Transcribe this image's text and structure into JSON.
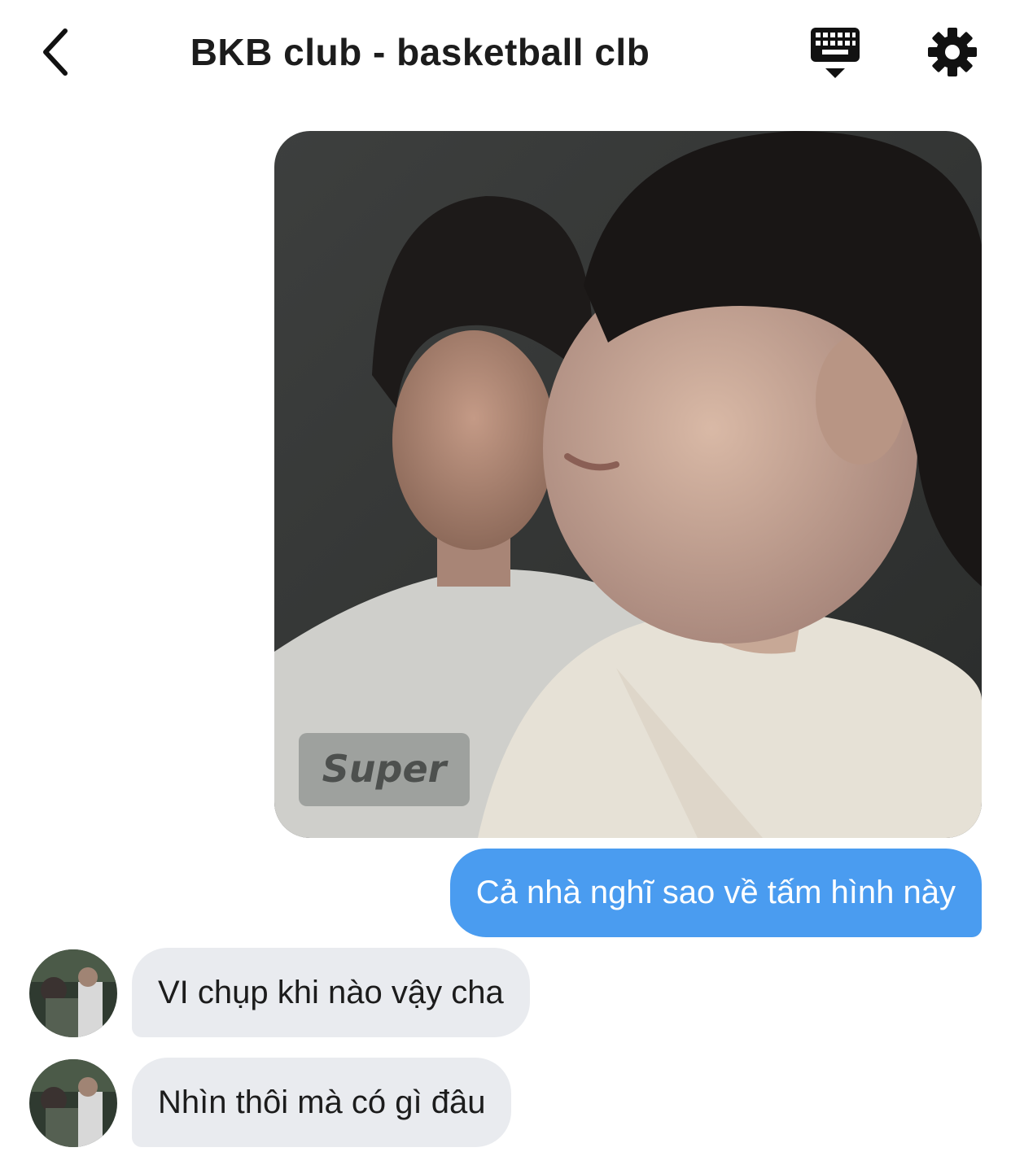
{
  "header": {
    "title": "BKB club - basketball clb",
    "back_icon": "chevron-left-icon",
    "keyboard_icon": "keyboard-hide-icon",
    "settings_icon": "gear-icon"
  },
  "messages": [
    {
      "type": "image",
      "direction": "outgoing",
      "content": "photo-of-two-people",
      "image_caption": "Super"
    },
    {
      "type": "text",
      "direction": "outgoing",
      "text": "Cả nhà nghĩ sao về tấm hình này"
    },
    {
      "type": "text",
      "direction": "incoming",
      "text": "VI chụp khi nào vậy cha"
    },
    {
      "type": "text",
      "direction": "incoming",
      "text": "Nhìn thôi mà có gì đâu"
    }
  ],
  "colors": {
    "outgoing_bubble": "#4a9cf0",
    "incoming_bubble": "#e9ebef",
    "title_text": "#1c1c1c",
    "icon": "#111111"
  }
}
